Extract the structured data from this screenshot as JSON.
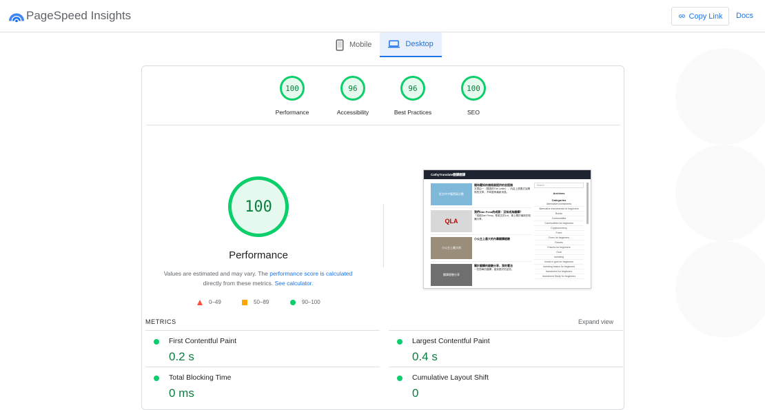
{
  "header": {
    "brand": "PageSpeed Insights",
    "copy_link_label": "Copy Link",
    "docs_label": "Docs",
    "logo_icon": "pagespeed-logo-icon",
    "colors": {
      "accent": "#1a73e8",
      "logo_blue": "#4285f4",
      "logo_dark": "#1a73e8"
    }
  },
  "tabs": [
    {
      "label": "Mobile",
      "icon": "mobile-icon",
      "active": false
    },
    {
      "label": "Desktop",
      "icon": "desktop-icon",
      "active": true
    }
  ],
  "gauges": [
    {
      "score": "100",
      "label": "Performance"
    },
    {
      "score": "96",
      "label": "Accessibility"
    },
    {
      "score": "96",
      "label": "Best Practices"
    },
    {
      "score": "100",
      "label": "SEO"
    }
  ],
  "performance": {
    "score": "100",
    "title": "Performance",
    "note_prefix": "Values are estimated and may vary. The",
    "note_link1": "performance score is calculated",
    "note_middle": "directly from these metrics.",
    "note_link2": "See calculator."
  },
  "legend": [
    {
      "range": "0–49",
      "color": "#ff4e42",
      "shape": "triangle"
    },
    {
      "range": "50–89",
      "color": "#ffa400",
      "shape": "square"
    },
    {
      "range": "90–100",
      "color": "#0cce6b",
      "shape": "circle"
    }
  ],
  "screenshot": {
    "site_title": "CathyTranslate翻譯翻譯",
    "posts": [
      {
        "title": "隨和覆知的價格展提供的並提價",
        "excerpt": "文章由一（雙語的The Letter），內容上提要式及關係的文章，不時發佈最新消息。",
        "thumb_text": "從文件中獲得高分數"
      },
      {
        "title": "我們Dan Pena的成耕：沒有成為翻譯？",
        "excerpt": "「成耕Dan Pena」是英文的Lot，事上關於最新的知識分享。",
        "thumb_text": "QLA"
      },
      {
        "title": "小公主上最大的內幕翻譯經驗",
        "excerpt": "",
        "thumb_text": "小公主上最大的"
      },
      {
        "title": "關於翻譯的經驗分享，我的看法",
        "excerpt": "一些簡單的翻譯，做到更好的品質。",
        "thumb_text": "翻譯經驗分享"
      }
    ],
    "sidebar": {
      "search_placeholder": "Search ...",
      "archives": "Archives",
      "categories": "Categories",
      "items": [
        "Alternative investments",
        "Alternative investments for beginners",
        "Bonds",
        "Commodities",
        "Commodities for beginners",
        "Cryptocurrency",
        "Forex",
        "Forex for beginners",
        "Futures",
        "Futures for beginners",
        "Gold",
        "Investing",
        "Invest in gold for beginners",
        "Investing basics for beginners",
        "Investment for beginners",
        "Investment Study for beginners"
      ]
    }
  },
  "metrics": {
    "heading": "METRICS",
    "expand_label": "Expand view",
    "items": [
      {
        "name": "First Contentful Paint",
        "value": "0.2 s"
      },
      {
        "name": "Largest Contentful Paint",
        "value": "0.4 s"
      },
      {
        "name": "Total Blocking Time",
        "value": "0 ms"
      },
      {
        "name": "Cumulative Layout Shift",
        "value": "0"
      }
    ]
  },
  "colors": {
    "good": "#0cce6b",
    "good_text": "#0a7d3f",
    "average": "#ffa400",
    "poor": "#ff4e42"
  }
}
